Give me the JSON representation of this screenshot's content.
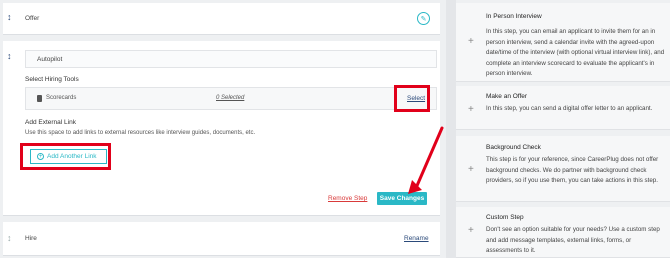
{
  "stages": {
    "offer_title": "Offer",
    "autopilot_title": "Autopilot",
    "hire_title": "Hire",
    "hire_action": "Rename"
  },
  "autopilot": {
    "hiring_tools_heading": "Select Hiring Tools",
    "scorecards_label": "Scorecards",
    "scorecards_selected": "0 Selected",
    "select_link": "Select",
    "external_heading": "Add External Link",
    "external_help": "Use this space to add links to external resources like interview guides, documents, etc.",
    "add_link_button": "Add Another Link",
    "remove_step": "Remove Step",
    "save_changes": "Save Changes"
  },
  "sidebar": {
    "cards": [
      {
        "title": "In Person Interview",
        "text": "In this step, you can email an applicant to invite them for an in person interview, send a calendar invite with the agreed-upon date/time of the interview (with optional virtual interview link), and complete an interview scorecard to evaluate the applicant's in person interview."
      },
      {
        "title": "Make an Offer",
        "text": "In this step, you can send a digital offer letter to an applicant."
      },
      {
        "title": "Background Check",
        "text": "This step is for your reference, since CareerPlug does not offer background checks. We do partner with background check providers, so if you use them, you can take actions in this step."
      },
      {
        "title": "Custom Step",
        "text": "Don't see an option suitable for your needs? Use a custom step and add message templates, external links, forms, or assessments to it."
      }
    ]
  },
  "colors": {
    "accent": "#2ab8c6",
    "highlight": "#e1001a",
    "link": "#2b4a7a",
    "danger": "#d93a3a"
  }
}
